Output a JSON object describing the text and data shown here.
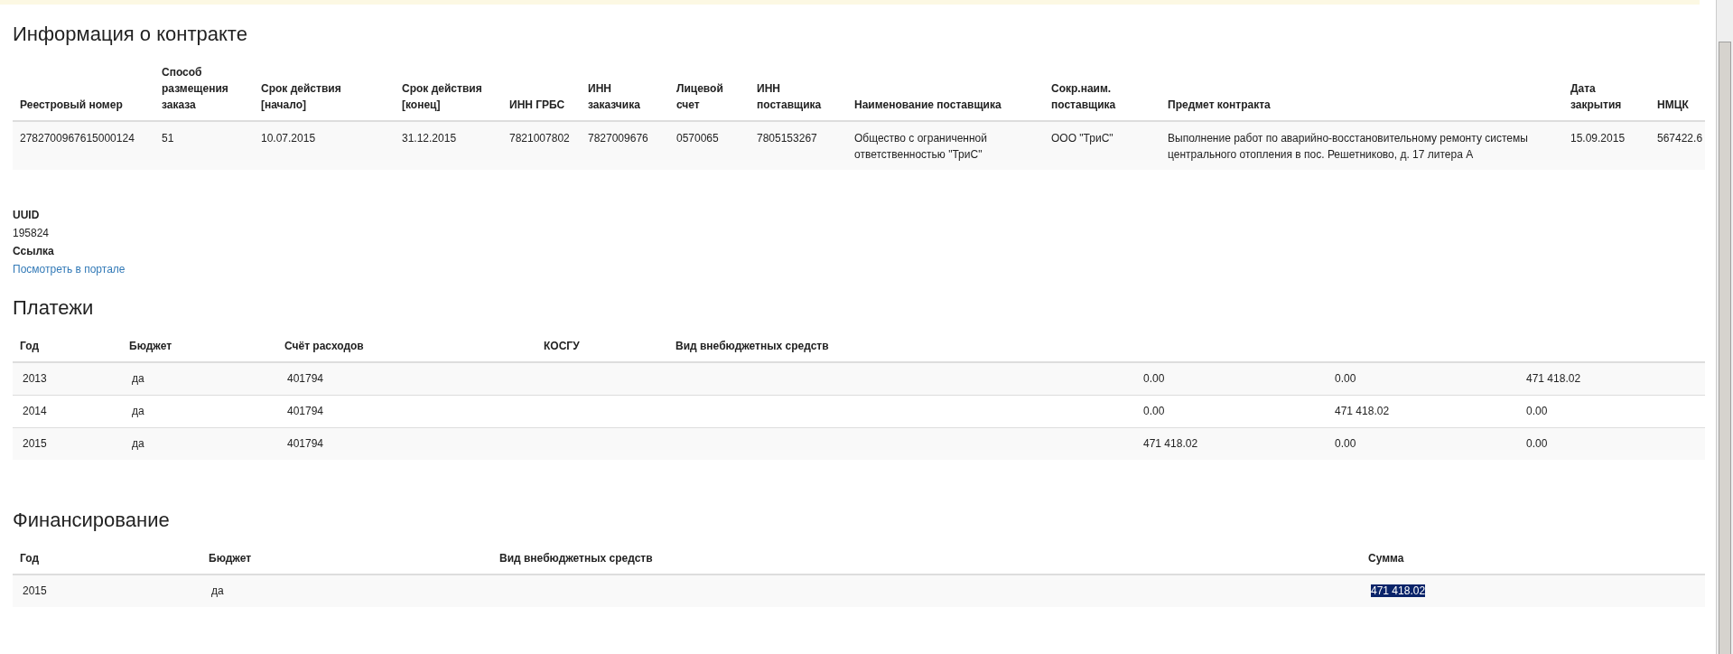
{
  "contract": {
    "title": "Информация о контракте",
    "columns": [
      "Реестровый номер",
      "Способ размещения заказа",
      "Срок действия [начало]",
      "Срок действия [конец]",
      "ИНН ГРБС",
      "ИНН заказчика",
      "Лицевой счет",
      "ИНН поставщика",
      "Наименование поставщика",
      "Сокр.наим. поставщика",
      "Предмет контракта",
      "Дата закрытия",
      "НМЦК"
    ],
    "rows": [
      [
        "2782700967615000124",
        "51",
        "10.07.2015",
        "31.12.2015",
        "7821007802",
        "7827009676",
        "0570065",
        "7805153267",
        "Общество с ограниченной ответственностью \"ТриС\"",
        "ООО \"ТриС\"",
        "Выполнение работ по аварийно-восстановительному ремонту системы центрального отопления в пос. Решетниково, д. 17 литера А",
        "15.09.2015",
        "567422.6"
      ]
    ]
  },
  "details": [
    {
      "label": "UUID",
      "value": "195824",
      "kind": "text"
    },
    {
      "label": "Ссылка",
      "value": "Посмотреть в портале",
      "kind": "link"
    }
  ],
  "payments": {
    "title": "Платежи",
    "columns": [
      "Год",
      "Бюджет",
      "Счёт расходов",
      "КОСГУ",
      "Вид внебюджетных средств"
    ],
    "rows": [
      {
        "year": "2013",
        "budget": "да",
        "account": "401794",
        "column_6": "0.00",
        "column_7": "0.00",
        "column_8": "471 418.02"
      },
      {
        "year": "2014",
        "budget": "да",
        "account": "401794",
        "column_6": "0.00",
        "column_7": "471 418.02",
        "column_8": "0.00"
      },
      {
        "year": "2015",
        "budget": "да",
        "account": "401794",
        "column_6": "471 418.02",
        "column_7": "0.00",
        "column_8": "0.00"
      }
    ]
  },
  "financing": {
    "title": "Финансирование",
    "columns": [
      "Год",
      "Бюджет",
      "Вид внебюджетных средств",
      "Сумма"
    ],
    "rows": [
      {
        "year": "2015",
        "budget": "да",
        "sum": "471 418.02",
        "sum_selected": true
      }
    ]
  }
}
